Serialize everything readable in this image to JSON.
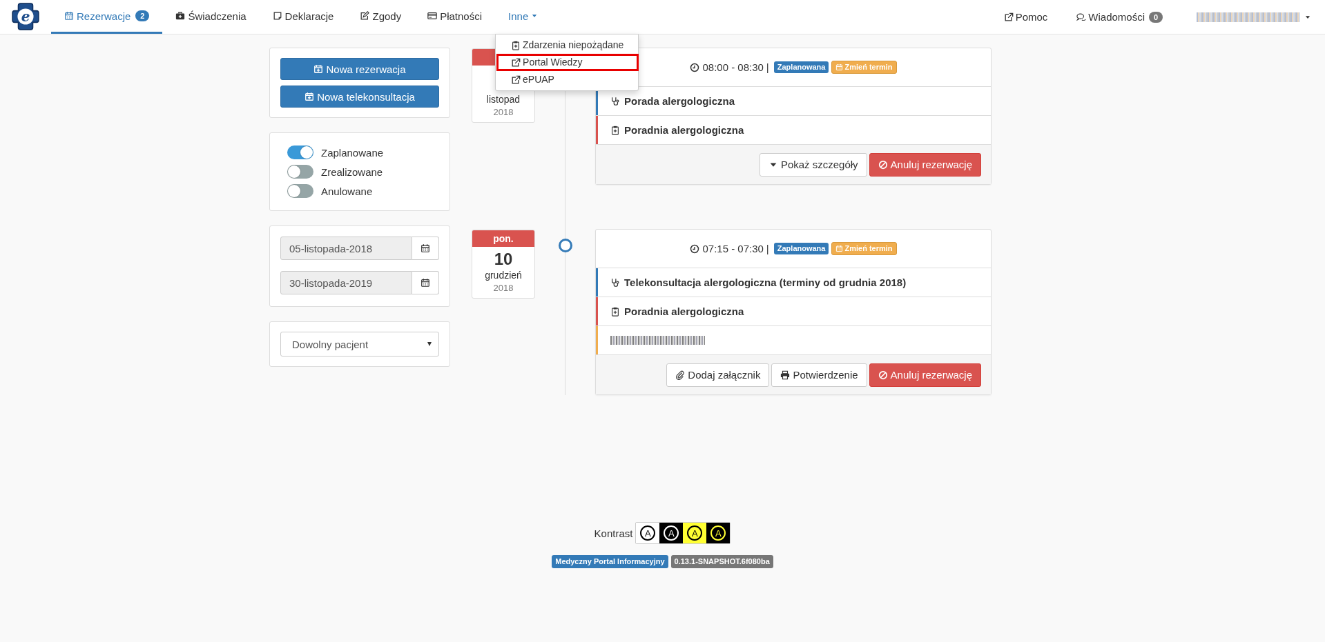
{
  "navbar": {
    "logo": {
      "letter": "e"
    },
    "tabs": [
      {
        "label": "Rezerwacje",
        "badge": "2",
        "selected": true
      },
      {
        "label": "Świadczenia",
        "selected": false
      },
      {
        "label": "Deklaracje",
        "selected": false
      },
      {
        "label": "Zgody",
        "selected": false
      },
      {
        "label": "Płatności",
        "selected": false
      },
      {
        "label": "Inne",
        "dropdown": true,
        "expanded": true,
        "selected": false
      }
    ],
    "dropdown_menu": [
      {
        "label": "Zdarzenia niepożądane",
        "outlined": false
      },
      {
        "label": "Portal Wiedzy",
        "outlined": true
      },
      {
        "label": "ePUAP",
        "outlined": false
      }
    ],
    "right_links": [
      {
        "label": "Pomoc"
      },
      {
        "label": "Wiadomości",
        "badge": "0"
      }
    ],
    "user_menu": {
      "redacted": true
    }
  },
  "sidebar": {
    "buttons": [
      {
        "label": "Nowa rezerwacja"
      },
      {
        "label": "Nowa telekonsultacja"
      }
    ],
    "filters": [
      {
        "label": "Zaplanowane",
        "on": true
      },
      {
        "label": "Zrealizowane",
        "on": false
      },
      {
        "label": "Anulowane",
        "on": false
      }
    ],
    "date_from": "05-listopada-2018",
    "date_to": "30-listopada-2019",
    "patient_select": "Dowolny pacjent"
  },
  "timeline": [
    {
      "date": {
        "month": "listopad",
        "year": "2018"
      },
      "marker": false,
      "time": "08:00 - 08:30",
      "separator": "|",
      "status": "Zaplanowana",
      "reschedule": "Zmień termin",
      "rows": [
        {
          "kind": "service",
          "text": "Porada alergologiczna",
          "color": "#337ab7"
        },
        {
          "kind": "clinic",
          "text": "Poradnia alergologiczna",
          "color": "#d9534f"
        }
      ],
      "actions": [
        {
          "kind": "details",
          "label": "Pokaż szczegóły"
        },
        {
          "kind": "cancel",
          "label": "Anuluj rezerwację"
        }
      ]
    },
    {
      "date": {
        "weekday": "pon.",
        "day": "10",
        "month": "grudzień",
        "year": "2018"
      },
      "marker": true,
      "time": "07:15 - 07:30",
      "separator": "|",
      "status": "Zaplanowana",
      "reschedule": "Zmień termin",
      "rows": [
        {
          "kind": "service",
          "text": "Telekonsultacja alergologiczna (terminy od grudnia 2018)",
          "color": "#337ab7"
        },
        {
          "kind": "clinic",
          "text": "Poradnia alergologiczna",
          "color": "#d9534f"
        },
        {
          "kind": "redacted",
          "color": "#f0ad4e"
        }
      ],
      "actions": [
        {
          "kind": "attach",
          "label": "Dodaj załącznik"
        },
        {
          "kind": "print",
          "label": "Potwierdzenie"
        },
        {
          "kind": "cancel",
          "label": "Anuluj rezerwację"
        }
      ]
    }
  ],
  "footer": {
    "contrast_label": "Kontrast",
    "contrast_options": [
      {
        "label": "A",
        "kind": "white-black"
      },
      {
        "label": "A",
        "kind": "black-white"
      },
      {
        "label": "A",
        "kind": "yellow-black"
      },
      {
        "label": "A",
        "kind": "black-yellow"
      }
    ],
    "app_name": "Medyczny Portal Informacyjny",
    "version": "0.13.1-SNAPSHOT.6f080ba"
  }
}
